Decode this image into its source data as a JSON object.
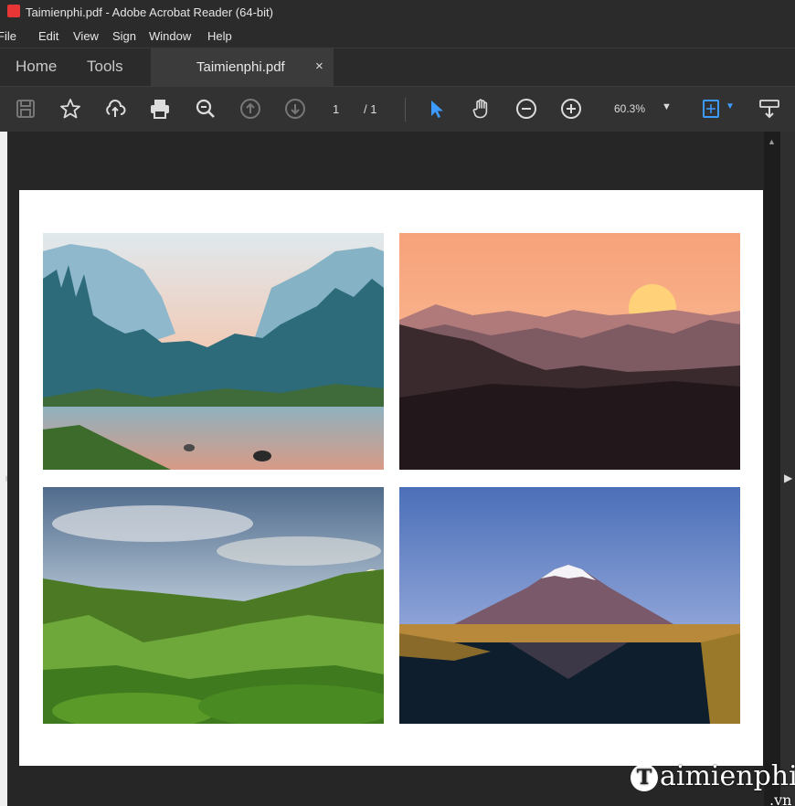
{
  "window": {
    "title": "Taimienphi.pdf - Adobe Acrobat Reader (64-bit)"
  },
  "menu": [
    "File",
    "Edit",
    "View",
    "Sign",
    "Window",
    "Help"
  ],
  "tabs": {
    "home": "Home",
    "tools": "Tools",
    "document": "Taimienphi.pdf",
    "close": "×"
  },
  "toolbar": {
    "page_current": "1",
    "page_total": "/ 1",
    "zoom": "60.3%",
    "icons": [
      "save-icon",
      "bookmark-star-icon",
      "upload-cloud-icon",
      "print-icon",
      "zoom-search-icon",
      "prev-page-icon",
      "next-page-icon",
      "select-cursor-icon",
      "hand-tool-icon",
      "zoom-out-icon",
      "zoom-in-icon",
      "fit-page-icon",
      "scroll-mode-icon"
    ],
    "accent_color": "#3d9bff"
  },
  "document": {
    "photos": [
      {
        "name": "valley-river",
        "description_colors": [
          "#9fc3d8",
          "#2d6b7a",
          "#f2a37e"
        ]
      },
      {
        "name": "sunset-mountains",
        "description_colors": [
          "#f7a27a",
          "#2b1e20",
          "#ffd27a"
        ]
      },
      {
        "name": "green-hills",
        "description_colors": [
          "#7a9ab8",
          "#4c7a24",
          "#f4e6c2"
        ]
      },
      {
        "name": "volcano-lake",
        "description_colors": [
          "#4b6fb8",
          "#e9a6c6",
          "#0f1e2c"
        ]
      }
    ]
  },
  "watermark": {
    "letter": "T",
    "text": "aimienphi",
    "suffix": ".vn"
  }
}
